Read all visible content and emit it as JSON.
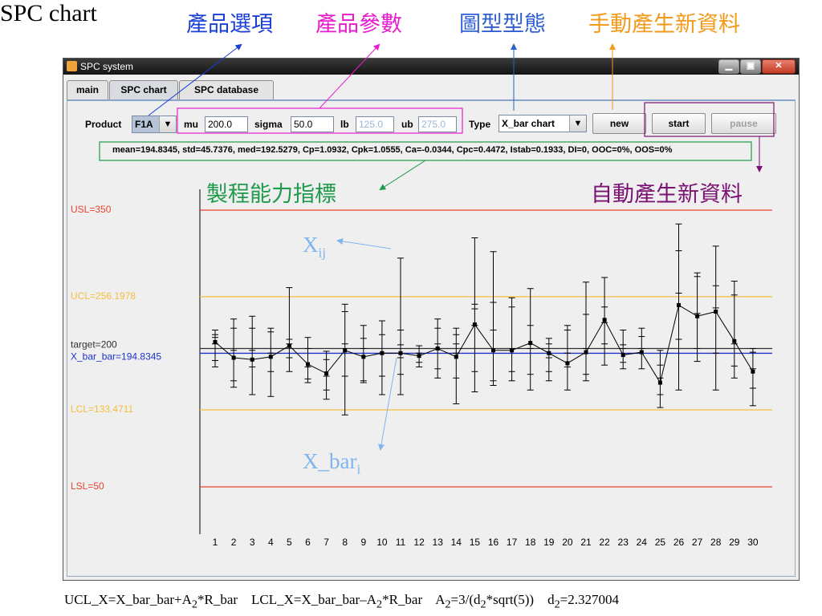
{
  "slide": {
    "title": "SPC chart",
    "annotations": {
      "product_option": "產品選項",
      "product_params": "產品參數",
      "chart_type": "圖型型態",
      "manual_new": "手動產生新資料",
      "capability": "製程能力指標",
      "auto_new": "自動產生新資料",
      "xij_base": "X",
      "xij_sub": "ij",
      "xbar_base": "X_bar",
      "xbar_sub": "i"
    },
    "formula": {
      "ucl_a": "UCL_X=X_bar_bar+A",
      "ucl_sub": "2",
      "ucl_b": "*R_bar",
      "lcl_a": "LCL_X=X_bar_bar–A",
      "lcl_sub": "2",
      "lcl_b": "*R_bar",
      "a2_a": "A",
      "a2_sub": "2",
      "a2_b": "=3/(d",
      "a2_sub2": "2",
      "a2_c": "*sqrt(5))",
      "d2_a": "d",
      "d2_sub": "2",
      "d2_b": "=2.327004"
    },
    "colors": {
      "product_option": "#1a3fd6",
      "product_params": "#e81ccf",
      "chart_type": "#2f5fd0",
      "manual_new": "#f39a1b",
      "capability": "#1f9a4a",
      "auto_new": "#7a1173",
      "x_anno": "#7fb4ef"
    }
  },
  "window": {
    "title": "SPC system",
    "minimize_icon": "minimize-icon",
    "maximize_icon": "maximize-icon",
    "close_icon": "close-icon",
    "tabs": [
      "main",
      "SPC chart",
      "SPC database"
    ],
    "selected_tab": "SPC chart"
  },
  "controls": {
    "product_label": "Product",
    "product_value": "F1A",
    "mu_label": "mu",
    "mu_value": "200.0",
    "sigma_label": "sigma",
    "sigma_value": "50.0",
    "lb_label": "lb",
    "lb_value": "125.0",
    "ub_label": "ub",
    "ub_value": "275.0",
    "type_label": "Type",
    "type_value": "X_bar chart",
    "new_label": "new",
    "start_label": "start",
    "pause_label": "pause",
    "dropdown_icon": "triangle-down-icon"
  },
  "stats_line": "mean=194.8345, std=45.7376, med=192.5279, Cp=1.0932, Cpk=1.0555, Ca=-0.0344, Cpc=0.4472, Istab=0.1933, DI=0, OOC=0%, OOS=0%",
  "chart_data": {
    "type": "line",
    "title": "",
    "xlabel": "",
    "ylabel": "",
    "ylim": [
      0,
      400
    ],
    "x": [
      1,
      2,
      3,
      4,
      5,
      6,
      7,
      8,
      9,
      10,
      11,
      12,
      13,
      14,
      15,
      16,
      17,
      18,
      19,
      20,
      21,
      22,
      23,
      24,
      25,
      26,
      27,
      28,
      29,
      30
    ],
    "xbar": [
      207,
      190,
      188,
      191,
      203,
      183,
      173,
      198,
      191,
      195,
      195,
      192,
      200,
      191,
      226,
      198,
      198,
      206,
      195,
      184,
      196,
      231,
      193,
      196,
      163,
      247,
      235,
      240,
      208,
      175
    ],
    "marks": [
      [
        180,
        187,
        205,
        212,
        215,
        220
      ],
      [
        158,
        165,
        198,
        222,
        232
      ],
      [
        150,
        180,
        198,
        222,
        235
      ],
      [
        148,
        175,
        195,
        218,
        222
      ],
      [
        175,
        190,
        205,
        210,
        266
      ],
      [
        163,
        167,
        180,
        200,
        212
      ],
      [
        145,
        155,
        170,
        188,
        197
      ],
      [
        128,
        170,
        205,
        240,
        248
      ],
      [
        163,
        165,
        200,
        211,
        225
      ],
      [
        150,
        170,
        195,
        215,
        230
      ],
      [
        150,
        172,
        190,
        204,
        220,
        298
      ],
      [
        180,
        185,
        195,
        203
      ],
      [
        168,
        178,
        205,
        222,
        232
      ],
      [
        140,
        168,
        195,
        205,
        215,
        222
      ],
      [
        153,
        175,
        225,
        243,
        248,
        320
      ],
      [
        160,
        165,
        220,
        250,
        305
      ],
      [
        165,
        175,
        200,
        245,
        255
      ],
      [
        155,
        172,
        200,
        225,
        265
      ],
      [
        165,
        175,
        190,
        205,
        211
      ],
      [
        155,
        180,
        195,
        220,
        225
      ],
      [
        165,
        172,
        200,
        237,
        272
      ],
      [
        182,
        205,
        228,
        245,
        277
      ],
      [
        178,
        185,
        200,
        204,
        220
      ],
      [
        178,
        200,
        213,
        222
      ],
      [
        136,
        150,
        168,
        182,
        198
      ],
      [
        155,
        210,
        260,
        306,
        335
      ],
      [
        186,
        200,
        238,
        278,
        282
      ],
      [
        155,
        195,
        244,
        268,
        311
      ],
      [
        168,
        181,
        205,
        258,
        273
      ],
      [
        138,
        157,
        178,
        196,
        200
      ]
    ],
    "lines": {
      "usl": 350,
      "ucl": 256.1978,
      "target": 200,
      "x_bar_bar": 194.8345,
      "lcl": 133.4711,
      "lsl": 50
    },
    "labels": {
      "usl": "USL=350",
      "ucl": "UCL=256.1978",
      "target": "target=200",
      "x_bar_bar": "X_bar_bar=194.8345",
      "lcl": "LCL=133.4711",
      "lsl": "LSL=50"
    },
    "colors": {
      "spec": "#e8432e",
      "control": "#f5be3c",
      "target": "#303030",
      "mean": "#1c34c8",
      "series": "#000000"
    },
    "grid": false,
    "legend": "none"
  }
}
